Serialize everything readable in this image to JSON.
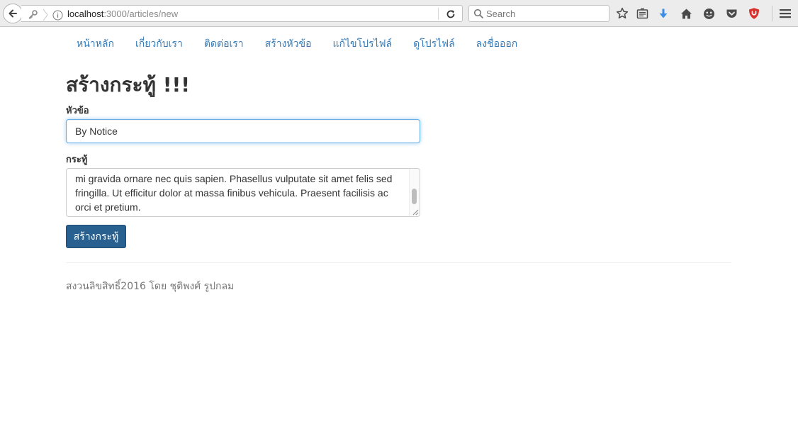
{
  "browser": {
    "url_host": "localhost",
    "url_rest": ":3000/articles/new",
    "search_placeholder": "Search",
    "icons": [
      "back-icon",
      "key-icon",
      "info-icon",
      "reload-icon",
      "search-icon",
      "bookmark-star-icon",
      "reading-list-icon",
      "download-icon",
      "home-icon",
      "emoji-icon",
      "pocket-icon",
      "ublock-icon",
      "menu-icon"
    ],
    "colors": {
      "download": "#3a8ee6",
      "ublock": "#d9302c"
    }
  },
  "nav": {
    "items": [
      {
        "label": "หน้าหลัก"
      },
      {
        "label": "เกี่ยวกับเรา"
      },
      {
        "label": "ติดต่อเรา"
      },
      {
        "label": "สร้างหัวข้อ"
      },
      {
        "label": "แก้ไขโปรไฟล์"
      },
      {
        "label": "ดูโปรไฟล์"
      },
      {
        "label": "ลงชื่อออก"
      }
    ],
    "link_color": "#337ab7"
  },
  "form": {
    "heading": "สร้างกระทู้ !!!",
    "title_label": "หัวข้อ",
    "title_value": "By Notice",
    "body_label": "กระทู้",
    "body_value": "mi gravida ornare nec quis sapien. Phasellus vulputate sit amet felis sed fringilla. Ut efficitur dolor at massa finibus vehicula. Praesent facilisis ac orci et pretium.",
    "submit_label": "สร้างกระทู้",
    "submit_color": "#286090"
  },
  "footer": {
    "text": "สงวนลิขสิทธิ์2016 โดย ชุติพงศ์ รูปกลม"
  }
}
